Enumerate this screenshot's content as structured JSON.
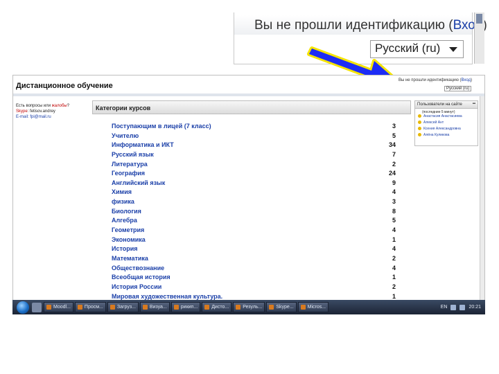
{
  "zoom": {
    "login_text": "Вы не прошли идентификацию (",
    "login_link": "Вход",
    "login_close": ")",
    "language": "Русский (ru)"
  },
  "site": {
    "title": "Дистанционное обучение",
    "mini_login_text": "Вы не прошли идентификацию (",
    "mini_login_link": "Вход",
    "mini_login_close": ")",
    "mini_language": "Русский (ru)"
  },
  "contact": {
    "line1_prefix": "Есть вопросы или ",
    "line1_link": "жалобы",
    "line1_suffix": "?",
    "line2_prefix": "Skype",
    "line2_rest": ": fetisov.andrey",
    "line3": "E-mail: fpi@mail.ru"
  },
  "categories": {
    "header": "Категории курсов",
    "items": [
      {
        "name": "Поступающим в лицей (7 класс)",
        "count": "3"
      },
      {
        "name": "Учителю",
        "count": "5"
      },
      {
        "name": "Информатика и ИКТ",
        "count": "34"
      },
      {
        "name": "Русский язык",
        "count": "7"
      },
      {
        "name": "Литература",
        "count": "2"
      },
      {
        "name": "География",
        "count": "24"
      },
      {
        "name": "Английский язык",
        "count": "9"
      },
      {
        "name": "Химия",
        "count": "4"
      },
      {
        "name": "физика",
        "count": "3"
      },
      {
        "name": "Биология",
        "count": "8"
      },
      {
        "name": "Алгебра",
        "count": "5"
      },
      {
        "name": "Геометрия",
        "count": "4"
      },
      {
        "name": "Экономика",
        "count": "1"
      },
      {
        "name": "История",
        "count": "4"
      },
      {
        "name": "Математика",
        "count": "2"
      },
      {
        "name": "Обществознание",
        "count": "4"
      },
      {
        "name": "Всеобщая история",
        "count": "1"
      },
      {
        "name": "История России",
        "count": "2"
      },
      {
        "name": "Мировая художественная культура.",
        "count": "1"
      }
    ]
  },
  "users_online": {
    "header": "Пользователи на сайте",
    "subtitle": "(последние 5 минут)",
    "users": [
      "Анастасия Анастасиева",
      "Алексей Ант",
      "Ксения Александровна",
      "Алёна Куликова"
    ]
  },
  "taskbar": {
    "buttons": [
      "Moodl...",
      "Просм...",
      "Загруз...",
      "Визуа...",
      "рикип...",
      "Дисто...",
      "Резуль...",
      "Skype...",
      "Micros..."
    ],
    "language": "EN",
    "time": "20:21"
  },
  "colors": {
    "link_blue": "#1a3fa8",
    "callout_blue": "#1d2cf5",
    "callout_yellow": "#f5e400"
  }
}
